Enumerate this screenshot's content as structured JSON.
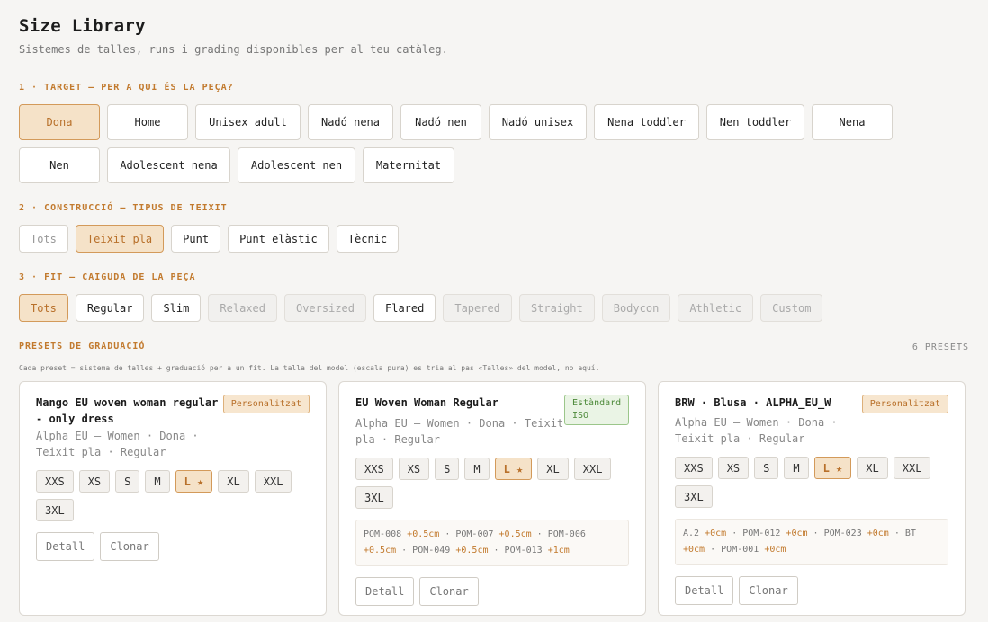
{
  "page": {
    "title": "Size Library",
    "subtitle": "Sistemes de talles, runs i grading disponibles per al teu catàleg."
  },
  "target": {
    "label": "1 · TARGET — PER A QUI ÉS LA PEÇA?",
    "options": [
      "Dona",
      "Home",
      "Unisex adult",
      "Nadó nena",
      "Nadó nen",
      "Nadó unisex",
      "Nena toddler",
      "Nen toddler",
      "Nena",
      "Nen",
      "Adolescent nena",
      "Adolescent nen",
      "Maternitat"
    ],
    "selected": "Dona"
  },
  "construction": {
    "label": "2 · CONSTRUCCIÓ — TIPUS DE TEIXIT",
    "options": [
      "Tots",
      "Teixit pla",
      "Punt",
      "Punt elàstic",
      "Tècnic"
    ],
    "selected": "Teixit pla"
  },
  "fit": {
    "label": "3 · FIT — CAIGUDA DE LA PEÇA",
    "options": [
      "Tots",
      "Regular",
      "Slim",
      "Relaxed",
      "Oversized",
      "Flared",
      "Tapered",
      "Straight",
      "Bodycon",
      "Athletic",
      "Custom"
    ],
    "selected": "Tots"
  },
  "presets": {
    "label": "PRESETS DE GRADUACIÓ",
    "count": "6 PRESETS",
    "note": "Cada preset = sistema de talles + graduació per a un fit. La talla del model (escala pura) es tria al pas «Talles» del model, no aquí.",
    "cards": [
      {
        "title": "Mango EU woven woman regular - only dress",
        "badge": "Personalitzat",
        "subtitle": "Alpha EU — Women · Dona · Teixit pla · Regular",
        "sizes": [
          "XXS",
          "XS",
          "S",
          "M",
          "L ★",
          "XL",
          "XXL",
          "3XL"
        ],
        "detail": "Detall",
        "clone": "Clonar"
      },
      {
        "title": "EU Woven Woman Regular",
        "badge": "Estàndard ISO",
        "subtitle": "Alpha EU — Women · Dona · Teixit pla · Regular",
        "sizes": [
          "XXS",
          "XS",
          "S",
          "M",
          "L ★",
          "XL",
          "XXL",
          "3XL"
        ],
        "pom": "POM-008 +0.5cm · POM-007 +0.5cm · POM-006 +0.5cm · POM-049 +0.5cm · POM-013 +1cm",
        "detail": "Detall",
        "clone": "Clonar"
      },
      {
        "title": "BRW · Blusa · ALPHA_EU_W",
        "badge": "Personalitzat",
        "subtitle": "Alpha EU — Women · Dona · Teixit pla · Regular",
        "sizes": [
          "XXS",
          "XS",
          "S",
          "M",
          "L ★",
          "XL",
          "XXL",
          "3XL"
        ],
        "pom": "A.2 +0cm · POM-012 +0cm · POM-023 +0cm · BT +0cm · POM-001 +0cm",
        "detail": "Detall",
        "clone": "Clonar"
      }
    ]
  }
}
